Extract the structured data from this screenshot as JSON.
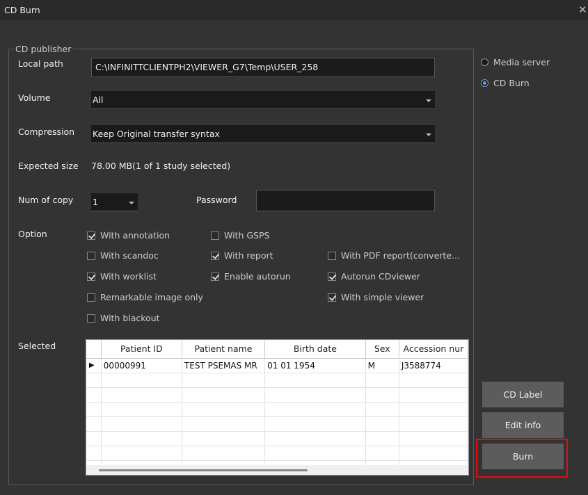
{
  "window": {
    "title": "CD Burn",
    "close_glyph": "✕"
  },
  "group": {
    "title": "CD publisher"
  },
  "local_path": {
    "label": "Local path",
    "value": "C:\\INFINITTCLIENTPH2\\VIEWER_G7\\Temp\\USER_258"
  },
  "volume": {
    "label": "Volume",
    "value": "All"
  },
  "compression": {
    "label": "Compression",
    "value": "Keep Original transfer syntax"
  },
  "expected_size": {
    "label": "Expected size",
    "value": "78.00 MB(1 of 1 study selected)"
  },
  "num_of_copy": {
    "label": "Num of copy",
    "value": "1"
  },
  "password": {
    "label": "Password",
    "value": ""
  },
  "option": {
    "label": "Option"
  },
  "options": [
    {
      "label": "With annotation",
      "checked": true
    },
    {
      "label": "With GSPS",
      "checked": false
    },
    {
      "label": "With scandoc",
      "checked": false
    },
    {
      "label": "With report",
      "checked": true
    },
    {
      "label": "With PDF report(converte...",
      "checked": false
    },
    {
      "label": "With worklist",
      "checked": true
    },
    {
      "label": "Enable autorun",
      "checked": true
    },
    {
      "label": "Autorun CDviewer",
      "checked": true
    },
    {
      "label": "Remarkable image only",
      "checked": false
    },
    {
      "label": "With simple viewer",
      "checked": true
    },
    {
      "label": "With blackout",
      "checked": false
    }
  ],
  "selected": {
    "label": "Selected",
    "columns": [
      "Patient ID",
      "Patient name",
      "Birth date",
      "Sex",
      "Accession nur"
    ],
    "rows": [
      {
        "indicator": "▶",
        "cells": [
          "00000991",
          "TEST PSEMAS  MR",
          "01 01 1954",
          "M",
          "J3588774"
        ]
      }
    ]
  },
  "target": {
    "media_server": {
      "label": "Media server",
      "selected": false
    },
    "cd_burn": {
      "label": "CD Burn",
      "selected": true
    }
  },
  "buttons": {
    "cd_label": "CD Label",
    "edit_info": "Edit info",
    "burn": "Burn"
  }
}
